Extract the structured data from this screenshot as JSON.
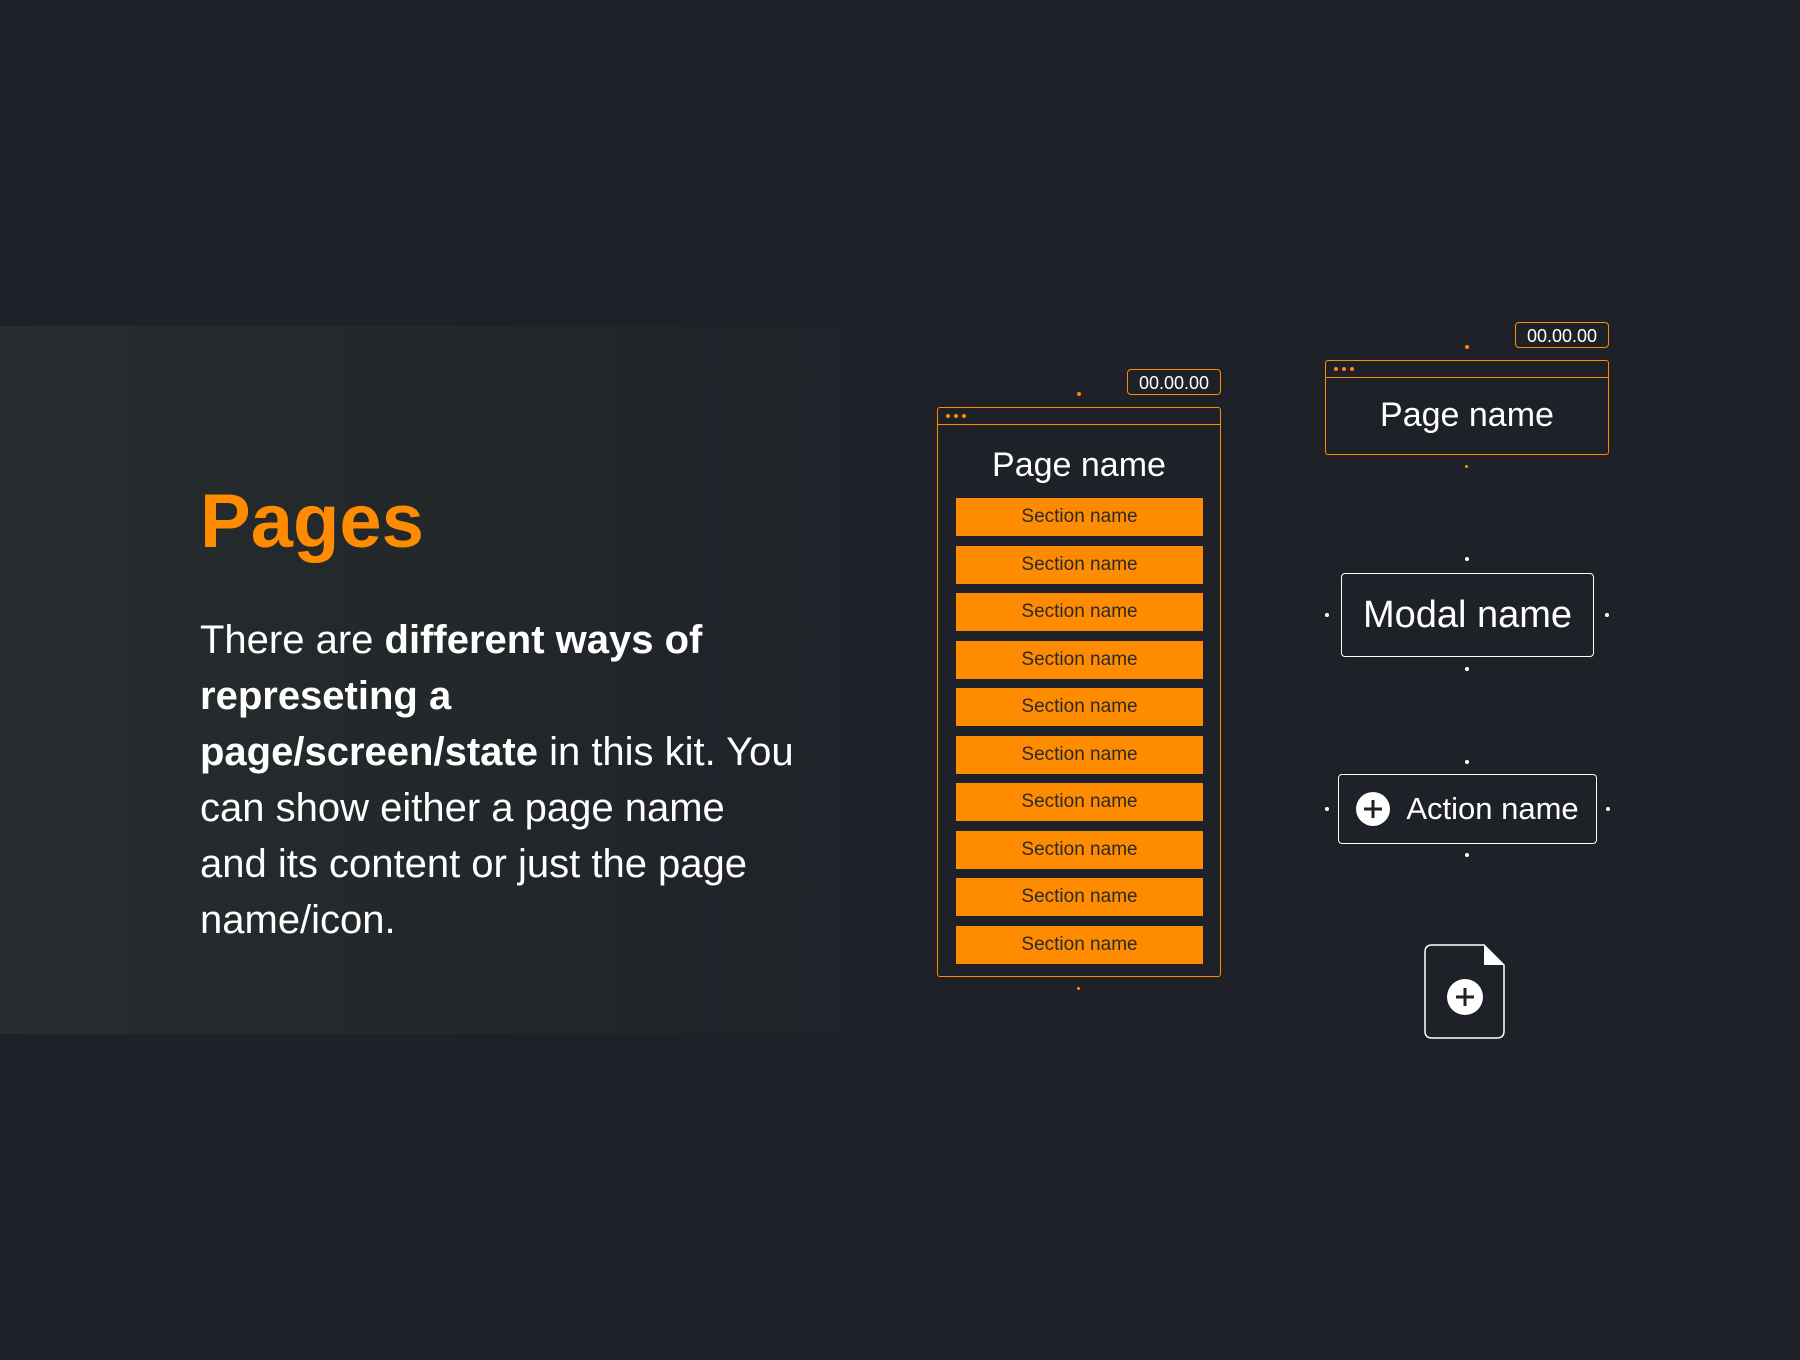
{
  "heading": "Pages",
  "description": {
    "part1": "There are ",
    "bold": "different ways of represeting a page/screen/state",
    "part2": " in this kit. You can show either a page name and its content or just the page name/icon."
  },
  "full_page": {
    "timestamp": "00.00.00",
    "title": "Page name",
    "sections": [
      "Section name",
      "Section name",
      "Section name",
      "Section name",
      "Section name",
      "Section name",
      "Section name",
      "Section name",
      "Section name",
      "Section name"
    ]
  },
  "compact_page": {
    "timestamp": "00.00.00",
    "title": "Page name"
  },
  "modal": {
    "label": "Modal name"
  },
  "action": {
    "label": "Action name",
    "icon": "plus-circle-icon"
  },
  "page_icon": {
    "icon": "add-page-icon"
  },
  "colors": {
    "background": "#1e2128",
    "accent": "#ff8c00",
    "text": "#ffffff"
  }
}
